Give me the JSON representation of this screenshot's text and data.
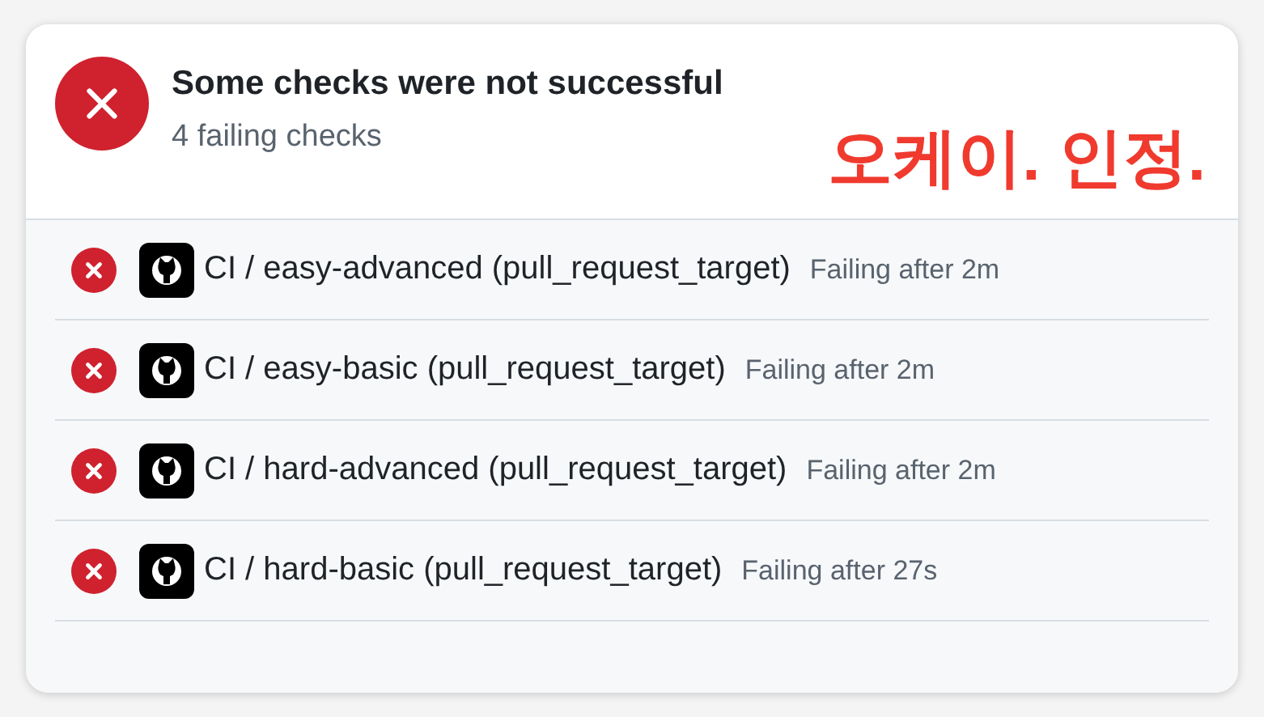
{
  "header": {
    "title": "Some checks were not successful",
    "subtitle": "4 failing checks",
    "kind": "failure"
  },
  "annotation": "오케이. 인정.",
  "checks": [
    {
      "name": "CI / easy-advanced (pull_request_target)",
      "detail": "Failing after 2m",
      "kind": "failure"
    },
    {
      "name": "CI / easy-basic (pull_request_target)",
      "detail": "Failing after 2m",
      "kind": "failure"
    },
    {
      "name": "CI / hard-advanced (pull_request_target)",
      "detail": "Failing after 2m",
      "kind": "failure"
    },
    {
      "name": "CI / hard-basic (pull_request_target)",
      "detail": "Failing after 27s",
      "kind": "failure"
    }
  ]
}
